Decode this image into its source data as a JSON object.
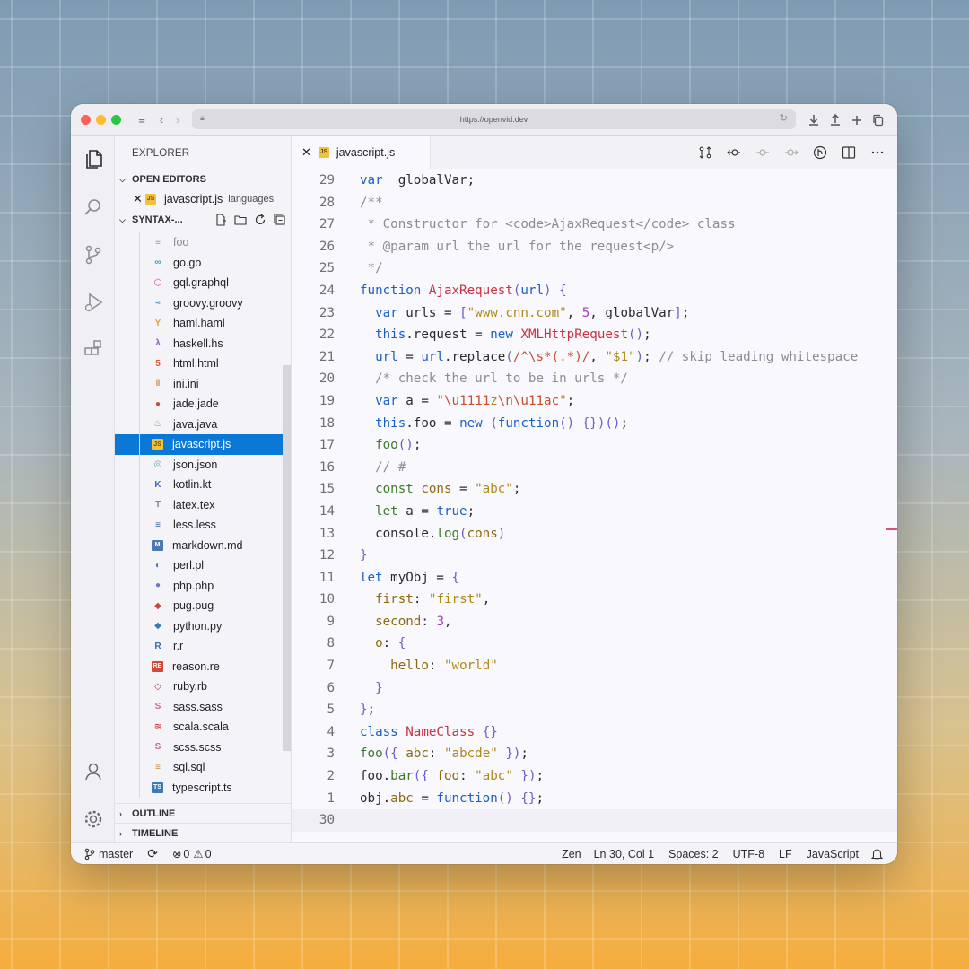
{
  "browser": {
    "url": "https://openvid.dev"
  },
  "sidebar": {
    "title": "EXPLORER",
    "open_editors_label": "OPEN EDITORS",
    "open_editor": {
      "name": "javascript.js",
      "description": "languages"
    },
    "folder_label": "SYNTAX-...",
    "files": [
      {
        "name": "foo",
        "icon": "file-icon",
        "dim": true
      },
      {
        "name": "go.go",
        "icon": "go-icon"
      },
      {
        "name": "gql.graphql",
        "icon": "graphql-icon"
      },
      {
        "name": "groovy.groovy",
        "icon": "groovy-icon"
      },
      {
        "name": "haml.haml",
        "icon": "haml-icon"
      },
      {
        "name": "haskell.hs",
        "icon": "haskell-icon"
      },
      {
        "name": "html.html",
        "icon": "html-icon"
      },
      {
        "name": "ini.ini",
        "icon": "ini-icon"
      },
      {
        "name": "jade.jade",
        "icon": "jade-icon"
      },
      {
        "name": "java.java",
        "icon": "java-icon"
      },
      {
        "name": "javascript.js",
        "icon": "js-icon",
        "active": true
      },
      {
        "name": "json.json",
        "icon": "json-icon"
      },
      {
        "name": "kotlin.kt",
        "icon": "kotlin-icon"
      },
      {
        "name": "latex.tex",
        "icon": "latex-icon"
      },
      {
        "name": "less.less",
        "icon": "less-icon"
      },
      {
        "name": "markdown.md",
        "icon": "markdown-icon"
      },
      {
        "name": "perl.pl",
        "icon": "perl-icon"
      },
      {
        "name": "php.php",
        "icon": "php-icon"
      },
      {
        "name": "pug.pug",
        "icon": "pug-icon"
      },
      {
        "name": "python.py",
        "icon": "python-icon"
      },
      {
        "name": "r.r",
        "icon": "r-icon"
      },
      {
        "name": "reason.re",
        "icon": "reason-icon"
      },
      {
        "name": "ruby.rb",
        "icon": "ruby-icon"
      },
      {
        "name": "sass.sass",
        "icon": "sass-icon"
      },
      {
        "name": "scala.scala",
        "icon": "scala-icon"
      },
      {
        "name": "scss.scss",
        "icon": "scss-icon"
      },
      {
        "name": "sql.sql",
        "icon": "sql-icon"
      },
      {
        "name": "typescript.ts",
        "icon": "typescript-icon"
      }
    ],
    "outline_label": "OUTLINE",
    "timeline_label": "TIMELINE"
  },
  "editor": {
    "tab_label": "javascript.js",
    "lines": [
      {
        "n": "29",
        "tokens": [
          [
            "kw",
            "var"
          ],
          [
            "",
            "  globalVar;"
          ]
        ]
      },
      {
        "n": "28",
        "tokens": [
          [
            "cmt",
            "/**"
          ]
        ]
      },
      {
        "n": "27",
        "tokens": [
          [
            "cmt",
            " * Constructor for <code>AjaxRequest</code> class"
          ]
        ]
      },
      {
        "n": "26",
        "tokens": [
          [
            "cmt",
            " * @param url the url for the request<p/>"
          ]
        ]
      },
      {
        "n": "25",
        "tokens": [
          [
            "cmt",
            " */"
          ]
        ]
      },
      {
        "n": "24",
        "tokens": [
          [
            "kw",
            "function "
          ],
          [
            "fn",
            "AjaxRequest"
          ],
          [
            "brk",
            "("
          ],
          [
            "kw",
            "url"
          ],
          [
            "brk",
            ")"
          ],
          [
            "",
            " "
          ],
          [
            "brk",
            "{"
          ]
        ]
      },
      {
        "n": "23",
        "tokens": [
          [
            "",
            "  "
          ],
          [
            "kw",
            "var"
          ],
          [
            "",
            " urls = "
          ],
          [
            "brk",
            "["
          ],
          [
            "str",
            "\"www.cnn.com\""
          ],
          [
            "",
            ", "
          ],
          [
            "num",
            "5"
          ],
          [
            "",
            ", globalVar"
          ],
          [
            "brk",
            "]"
          ],
          [
            "",
            ";"
          ]
        ]
      },
      {
        "n": "22",
        "tokens": [
          [
            "",
            "  "
          ],
          [
            "kw",
            "this"
          ],
          [
            "",
            ".request = "
          ],
          [
            "kw",
            "new "
          ],
          [
            "fn",
            "XMLHttpRequest"
          ],
          [
            "brk",
            "()"
          ],
          [
            "",
            ";"
          ]
        ]
      },
      {
        "n": "21",
        "tokens": [
          [
            "",
            "  "
          ],
          [
            "kw",
            "url"
          ],
          [
            "",
            " = "
          ],
          [
            "kw",
            "url"
          ],
          [
            "",
            ".replace"
          ],
          [
            "brk",
            "("
          ],
          [
            "rx",
            "/^\\s*(.*)/"
          ],
          [
            "",
            ", "
          ],
          [
            "str",
            "\"$1\""
          ],
          [
            "brk",
            ")"
          ],
          [
            "",
            "; "
          ],
          [
            "cmt",
            "// skip leading whitespace"
          ]
        ]
      },
      {
        "n": "20",
        "tokens": [
          [
            "",
            "  "
          ],
          [
            "cmt",
            "/* check the url to be in urls */"
          ]
        ]
      },
      {
        "n": "19",
        "tokens": [
          [
            "",
            "  "
          ],
          [
            "kw",
            "var"
          ],
          [
            "",
            " a = "
          ],
          [
            "str",
            "\""
          ],
          [
            "rx",
            "\\u1111"
          ],
          [
            "str",
            "z"
          ],
          [
            "rx",
            "\\n\\u11ac"
          ],
          [
            "str",
            "\""
          ],
          [
            "",
            ";"
          ]
        ]
      },
      {
        "n": "18",
        "tokens": [
          [
            "",
            "  "
          ],
          [
            "kw",
            "this"
          ],
          [
            "",
            ".foo = "
          ],
          [
            "kw",
            "new "
          ],
          [
            "brk",
            "("
          ],
          [
            "kw",
            "function"
          ],
          [
            "brk",
            "() {}"
          ],
          [
            "brk",
            ")()"
          ],
          [
            "",
            ";"
          ]
        ]
      },
      {
        "n": "17",
        "tokens": [
          [
            "",
            "  "
          ],
          [
            "this",
            "foo"
          ],
          [
            "brk",
            "()"
          ],
          [
            "",
            ";"
          ]
        ]
      },
      {
        "n": "16",
        "tokens": [
          [
            "",
            "  "
          ],
          [
            "cmt",
            "// #"
          ]
        ]
      },
      {
        "n": "15",
        "tokens": [
          [
            "",
            "  "
          ],
          [
            "this",
            "const "
          ],
          [
            "prop",
            "cons"
          ],
          [
            "",
            " = "
          ],
          [
            "str",
            "\"abc\""
          ],
          [
            "",
            ";"
          ]
        ]
      },
      {
        "n": "14",
        "tokens": [
          [
            "",
            "  "
          ],
          [
            "this",
            "let"
          ],
          [
            "",
            " a = "
          ],
          [
            "kw",
            "true"
          ],
          [
            "",
            ";"
          ]
        ]
      },
      {
        "n": "13",
        "tokens": [
          [
            "",
            "  console."
          ],
          [
            "this",
            "log"
          ],
          [
            "brk",
            "("
          ],
          [
            "prop",
            "cons"
          ],
          [
            "brk",
            ")"
          ]
        ]
      },
      {
        "n": "12",
        "tokens": [
          [
            "brk",
            "}"
          ]
        ]
      },
      {
        "n": "11",
        "tokens": [
          [
            "kw",
            "let"
          ],
          [
            "",
            " myObj = "
          ],
          [
            "brk",
            "{"
          ]
        ]
      },
      {
        "n": "10",
        "tokens": [
          [
            "",
            "  "
          ],
          [
            "prop",
            "first"
          ],
          [
            "",
            ": "
          ],
          [
            "str",
            "\"first\""
          ],
          [
            "",
            ","
          ]
        ]
      },
      {
        "n": "9",
        "tokens": [
          [
            "",
            "  "
          ],
          [
            "prop",
            "second"
          ],
          [
            "",
            ": "
          ],
          [
            "num",
            "3"
          ],
          [
            "",
            ","
          ]
        ]
      },
      {
        "n": "8",
        "tokens": [
          [
            "",
            "  "
          ],
          [
            "prop",
            "o"
          ],
          [
            "",
            ": "
          ],
          [
            "brk",
            "{"
          ]
        ]
      },
      {
        "n": "7",
        "tokens": [
          [
            "",
            "    "
          ],
          [
            "prop",
            "hello"
          ],
          [
            "",
            ": "
          ],
          [
            "str",
            "\"world\""
          ]
        ]
      },
      {
        "n": "6",
        "tokens": [
          [
            "",
            "  "
          ],
          [
            "brk",
            "}"
          ]
        ]
      },
      {
        "n": "5",
        "tokens": [
          [
            "brk",
            "}"
          ],
          [
            "",
            ";"
          ]
        ]
      },
      {
        "n": "4",
        "tokens": [
          [
            "kw",
            "class "
          ],
          [
            "fn",
            "NameClass"
          ],
          [
            "",
            " "
          ],
          [
            "brk",
            "{}"
          ]
        ]
      },
      {
        "n": "3",
        "tokens": [
          [
            "this",
            "foo"
          ],
          [
            "brk",
            "({"
          ],
          [
            "",
            ""
          ],
          [
            "",
            " "
          ],
          [
            "prop",
            "abc"
          ],
          [
            "",
            ": "
          ],
          [
            "str",
            "\"abcde\""
          ],
          [
            "",
            " "
          ],
          [
            "brk",
            "})"
          ],
          [
            "",
            ";"
          ]
        ]
      },
      {
        "n": "2",
        "tokens": [
          [
            "",
            "foo."
          ],
          [
            "this",
            "bar"
          ],
          [
            "brk",
            "({"
          ],
          [
            "",
            " "
          ],
          [
            "prop",
            "foo"
          ],
          [
            "",
            ": "
          ],
          [
            "str",
            "\"abc\""
          ],
          [
            "",
            " "
          ],
          [
            "brk",
            "})"
          ],
          [
            "",
            ";"
          ]
        ]
      },
      {
        "n": "1",
        "tokens": [
          [
            "",
            "obj."
          ],
          [
            "prop",
            "abc"
          ],
          [
            "",
            " = "
          ],
          [
            "kw",
            "function"
          ],
          [
            "brk",
            "() {}"
          ],
          [
            "",
            ";"
          ]
        ]
      },
      {
        "n": "30",
        "tokens": [],
        "current": true
      }
    ]
  },
  "status": {
    "branch": "master",
    "errors": "0",
    "warnings": "0",
    "zen": "Zen",
    "cursor": "Ln 30, Col 1",
    "spaces": "Spaces: 2",
    "encoding": "UTF-8",
    "eol": "LF",
    "language": "JavaScript"
  }
}
